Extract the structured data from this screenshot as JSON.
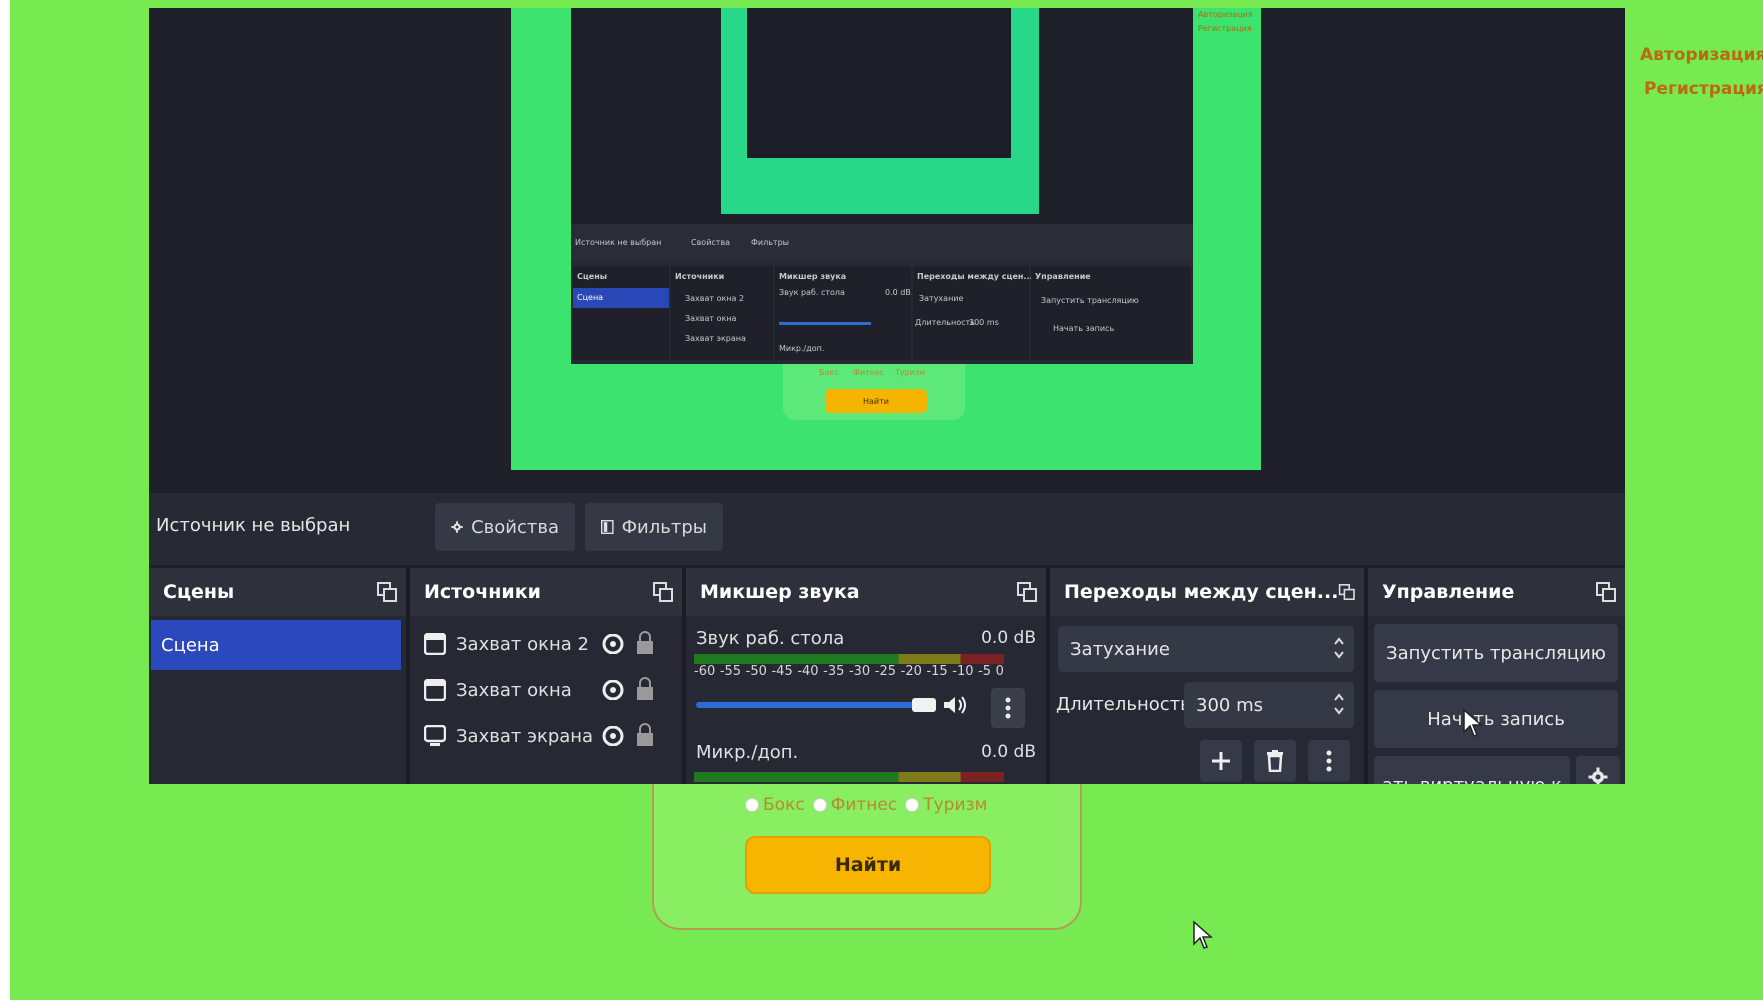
{
  "header": {
    "auth_links": [
      "Авторизация",
      "Регистрация"
    ]
  },
  "search": {
    "options": [
      "Бокс",
      "Фитнес",
      "Туризм"
    ],
    "find_button": "Найти"
  },
  "obs": {
    "nested_preview": {
      "no_source": "Источник не выбран",
      "properties": "Свойства",
      "filters": "Фильтры",
      "scenes": "Сцены",
      "sources": "Источники",
      "mixer": "Микшер звука",
      "transitions": "Переходы между сцен...",
      "controls": "Управление",
      "scene": "Сцена",
      "source_items": [
        "Захват окна 2",
        "Захват окна",
        "Захват экрана"
      ],
      "track": "Звук раб. стола",
      "mic": "Микр./доп.",
      "db": "0.0 dB",
      "fade": "Затухание",
      "duration_label": "Длительность",
      "duration": "300 ms",
      "start_stream": "Запустить трансляцию",
      "start_record": "Начать запись",
      "find": "Найти",
      "radios": [
        "Бокс",
        "Фитнес",
        "Туризм"
      ],
      "auth": [
        "Авторизация",
        "Регистрация"
      ]
    },
    "status_bar": {
      "no_source": "Источник не выбран",
      "properties_button": "Свойства",
      "filters_button": "Фильтры"
    },
    "docks": {
      "scenes": {
        "title": "Сцены",
        "items": [
          "Сцена"
        ]
      },
      "sources": {
        "title": "Источники",
        "items": [
          "Захват окна 2",
          "Захват окна",
          "Захват экрана"
        ]
      },
      "mixer": {
        "title": "Микшер звука",
        "tracks": [
          {
            "name": "Звук раб. стола",
            "db": "0.0 dB"
          },
          {
            "name": "Микр./доп.",
            "db": "0.0 dB"
          }
        ],
        "ticks": [
          "-60",
          "-55",
          "-50",
          "-45",
          "-40",
          "-35",
          "-30",
          "-25",
          "-20",
          "-15",
          "-10",
          "-5",
          "0"
        ]
      },
      "transitions": {
        "title": "Переходы между сцен...",
        "transition": "Затухание",
        "duration_label": "Длительность",
        "duration": "300 ms"
      },
      "controls": {
        "title": "Управление",
        "start_stream": "Запустить трансляцию",
        "start_record": "Начать запись",
        "virtual_camera": "ать виртуальную к"
      }
    }
  },
  "colors": {
    "page_green": "#77ea52",
    "obs_bg": "#1f2029",
    "scene_selected": "#2b48bc",
    "find_button": "#f7b401",
    "auth_link": "#b96a12"
  }
}
